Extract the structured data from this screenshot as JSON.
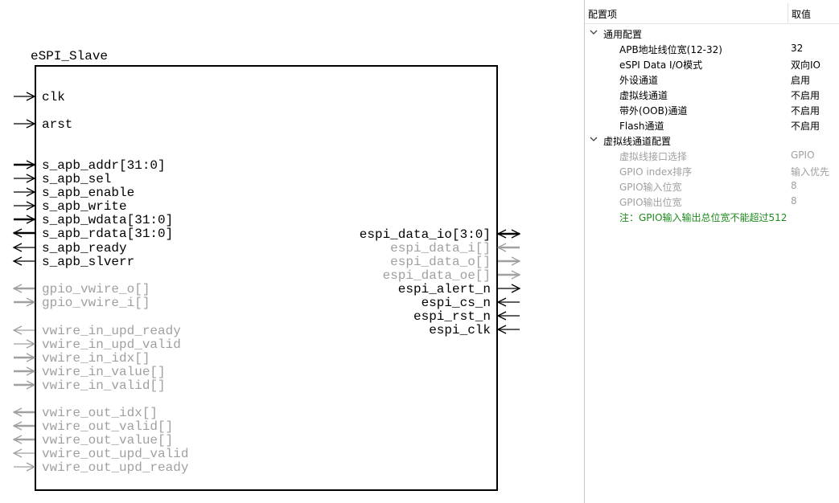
{
  "diagram": {
    "module_name": "eSPI_Slave",
    "left_ports": [
      {
        "label": "clk",
        "dir": "in",
        "bus": false,
        "disabled": false
      },
      {
        "label": "arst",
        "dir": "in",
        "bus": false,
        "disabled": false
      },
      {
        "label": "s_apb_addr[31:0]",
        "dir": "in",
        "bus": true,
        "disabled": false
      },
      {
        "label": "s_apb_sel",
        "dir": "in",
        "bus": false,
        "disabled": false
      },
      {
        "label": "s_apb_enable",
        "dir": "in",
        "bus": false,
        "disabled": false
      },
      {
        "label": "s_apb_write",
        "dir": "in",
        "bus": false,
        "disabled": false
      },
      {
        "label": "s_apb_wdata[31:0]",
        "dir": "in",
        "bus": true,
        "disabled": false
      },
      {
        "label": "s_apb_rdata[31:0]",
        "dir": "out",
        "bus": true,
        "disabled": false
      },
      {
        "label": "s_apb_ready",
        "dir": "out",
        "bus": false,
        "disabled": false
      },
      {
        "label": "s_apb_slverr",
        "dir": "out",
        "bus": false,
        "disabled": false
      },
      {
        "label": "gpio_vwire_o[]",
        "dir": "out",
        "bus": true,
        "disabled": true
      },
      {
        "label": "gpio_vwire_i[]",
        "dir": "in",
        "bus": true,
        "disabled": true
      },
      {
        "label": "vwire_in_upd_ready",
        "dir": "out",
        "bus": false,
        "disabled": true
      },
      {
        "label": "vwire_in_upd_valid",
        "dir": "in",
        "bus": false,
        "disabled": true
      },
      {
        "label": "vwire_in_idx[]",
        "dir": "in",
        "bus": true,
        "disabled": true
      },
      {
        "label": "vwire_in_value[]",
        "dir": "in",
        "bus": true,
        "disabled": true
      },
      {
        "label": "vwire_in_valid[]",
        "dir": "in",
        "bus": true,
        "disabled": true
      },
      {
        "label": "vwire_out_idx[]",
        "dir": "out",
        "bus": true,
        "disabled": true
      },
      {
        "label": "vwire_out_valid[]",
        "dir": "out",
        "bus": true,
        "disabled": true
      },
      {
        "label": "vwire_out_value[]",
        "dir": "out",
        "bus": true,
        "disabled": true
      },
      {
        "label": "vwire_out_upd_valid",
        "dir": "out",
        "bus": false,
        "disabled": true
      },
      {
        "label": "vwire_out_upd_ready",
        "dir": "in",
        "bus": false,
        "disabled": true
      }
    ],
    "right_ports": [
      {
        "label": "espi_data_io[3:0]",
        "dir": "inout",
        "bus": true,
        "disabled": false
      },
      {
        "label": "espi_data_i[]",
        "dir": "in",
        "bus": true,
        "disabled": true
      },
      {
        "label": "espi_data_o[]",
        "dir": "out",
        "bus": true,
        "disabled": true
      },
      {
        "label": "espi_data_oe[]",
        "dir": "out",
        "bus": true,
        "disabled": true
      },
      {
        "label": "espi_alert_n",
        "dir": "out",
        "bus": false,
        "disabled": false
      },
      {
        "label": "espi_cs_n",
        "dir": "in",
        "bus": false,
        "disabled": false
      },
      {
        "label": "espi_rst_n",
        "dir": "in",
        "bus": false,
        "disabled": false
      },
      {
        "label": "espi_clk",
        "dir": "in",
        "bus": false,
        "disabled": false
      }
    ]
  },
  "config": {
    "col_name": "配置项",
    "col_value": "取值",
    "groups": [
      {
        "title": "通用配置",
        "items": [
          {
            "name": "APB地址线位宽(12-32)",
            "value": "32",
            "disabled": false
          },
          {
            "name": "eSPI Data I/O模式",
            "value": "双向IO",
            "disabled": false
          },
          {
            "name": "外设通道",
            "value": "启用",
            "disabled": false
          },
          {
            "name": "虚拟线通道",
            "value": "不启用",
            "disabled": false
          },
          {
            "name": "带外(OOB)通道",
            "value": "不启用",
            "disabled": false
          },
          {
            "name": "Flash通道",
            "value": "不启用",
            "disabled": false
          }
        ]
      },
      {
        "title": "虚拟线通道配置",
        "items": [
          {
            "name": "虚拟线接口选择",
            "value": "GPIO",
            "disabled": true
          },
          {
            "name": "GPIO index排序",
            "value": "输入优先",
            "disabled": true
          },
          {
            "name": "GPIO输入位宽",
            "value": "8",
            "disabled": true
          },
          {
            "name": "GPIO输出位宽",
            "value": "8",
            "disabled": true
          }
        ]
      }
    ],
    "note": "注：GPIO输入输出总位宽不能超过512"
  },
  "colors": {
    "enabled": "#000000",
    "disabled": "#a0a0a0",
    "note": "#1d8b1d"
  }
}
